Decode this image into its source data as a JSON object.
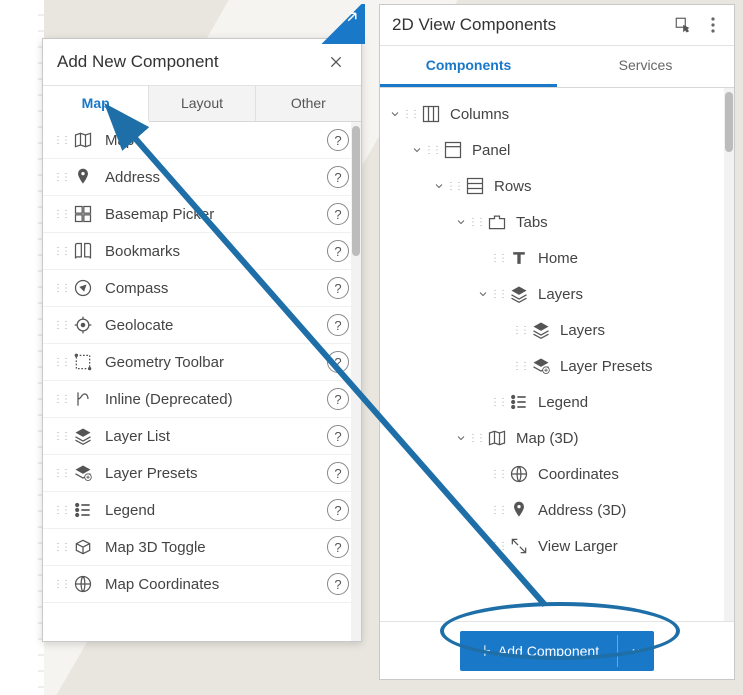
{
  "left": {
    "title": "Add New Component",
    "tabs": [
      "Map",
      "Layout",
      "Other"
    ],
    "activeTab": 0,
    "items": [
      {
        "label": "Map",
        "icon": "map"
      },
      {
        "label": "Address",
        "icon": "pin"
      },
      {
        "label": "Basemap Picker",
        "icon": "grid"
      },
      {
        "label": "Bookmarks",
        "icon": "book"
      },
      {
        "label": "Compass",
        "icon": "compass"
      },
      {
        "label": "Geolocate",
        "icon": "target"
      },
      {
        "label": "Geometry Toolbar",
        "icon": "geom"
      },
      {
        "label": "Inline (Deprecated)",
        "icon": "inline"
      },
      {
        "label": "Layer List",
        "icon": "layers"
      },
      {
        "label": "Layer Presets",
        "icon": "presets"
      },
      {
        "label": "Legend",
        "icon": "legend"
      },
      {
        "label": "Map 3D Toggle",
        "icon": "3d"
      },
      {
        "label": "Map Coordinates",
        "icon": "coords"
      }
    ]
  },
  "right": {
    "title": "2D View Components",
    "tabs": [
      "Components",
      "Services"
    ],
    "activeTab": 0,
    "addButton": {
      "label": "Add Component"
    },
    "tree": [
      {
        "d": 0,
        "exp": true,
        "icon": "columns",
        "label": "Columns"
      },
      {
        "d": 1,
        "exp": true,
        "icon": "panel",
        "label": "Panel"
      },
      {
        "d": 2,
        "exp": true,
        "icon": "rows",
        "label": "Rows"
      },
      {
        "d": 3,
        "exp": true,
        "icon": "tabs",
        "label": "Tabs"
      },
      {
        "d": 4,
        "exp": null,
        "icon": "text",
        "label": "Home"
      },
      {
        "d": 4,
        "exp": true,
        "icon": "layers",
        "label": "Layers"
      },
      {
        "d": 5,
        "exp": null,
        "icon": "layers",
        "label": "Layers"
      },
      {
        "d": 5,
        "exp": null,
        "icon": "presets",
        "label": "Layer Presets"
      },
      {
        "d": 4,
        "exp": null,
        "icon": "legend",
        "label": "Legend"
      },
      {
        "d": 3,
        "exp": true,
        "icon": "map",
        "label": "Map (3D)"
      },
      {
        "d": 4,
        "exp": null,
        "icon": "coords",
        "label": "Coordinates"
      },
      {
        "d": 4,
        "exp": null,
        "icon": "pin",
        "label": "Address (3D)"
      },
      {
        "d": 4,
        "exp": null,
        "icon": "expand",
        "label": "View Larger"
      }
    ]
  }
}
